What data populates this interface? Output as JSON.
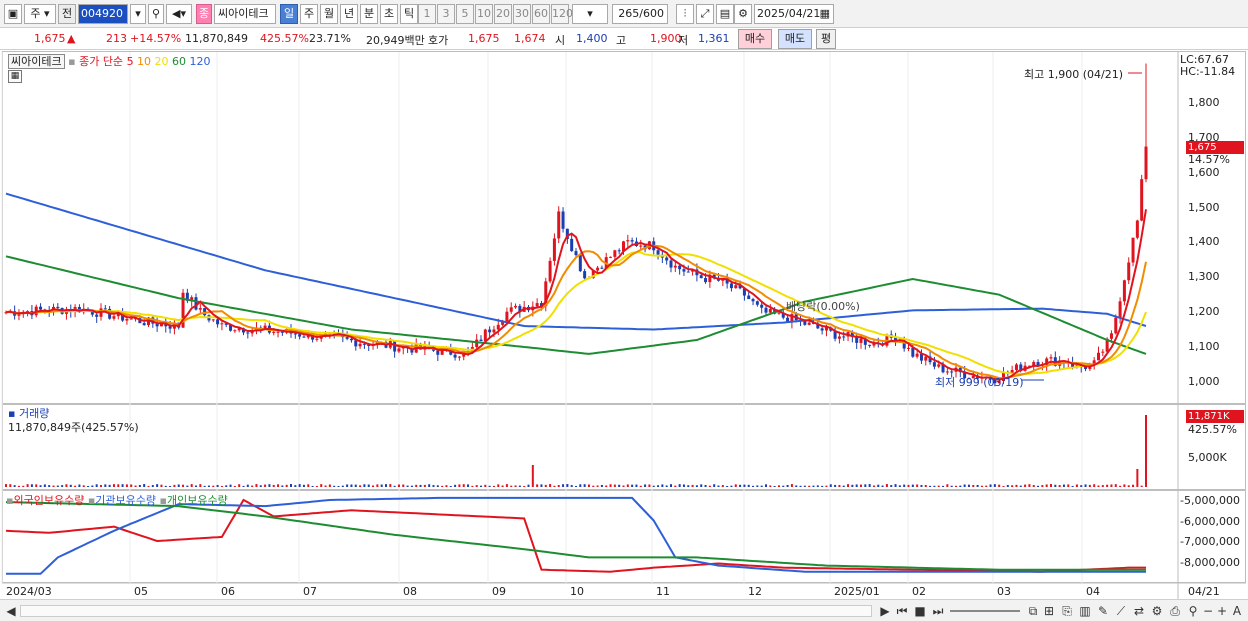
{
  "toolbar": {
    "type_label": "주",
    "prev_label": "전",
    "code_value": "004920",
    "company_badge": "종",
    "company_name": "씨아이테크",
    "periods": [
      "일",
      "주",
      "월",
      "년",
      "분",
      "초",
      "틱"
    ],
    "selected_period": "일",
    "minutes": [
      "1",
      "3",
      "5",
      "10",
      "20",
      "30",
      "60",
      "120"
    ],
    "count_value": "265",
    "count_total": "/600",
    "date_value": "2025/04/21"
  },
  "quote": {
    "price": "1,675",
    "change": "213",
    "change_pct": "+14.57%",
    "volume": "11,870,849",
    "volume_pct": "425.57%",
    "turnover": "23.71%",
    "amount": "20,949백만",
    "ask_label": "호가",
    "ask1": "1,675",
    "ask2": "1,674",
    "open_label": "시",
    "open": "1,400",
    "high_label": "고",
    "high": "1,900",
    "low_label": "저",
    "low": "1,361",
    "buy_label": "매수",
    "sell_label": "매도",
    "avg_label": "평"
  },
  "price_pane": {
    "stock_name": "씨아이테크",
    "ma_title": "종가 단순",
    "ma_periods": [
      "5",
      "10",
      "20",
      "60",
      "120"
    ],
    "ma_colors": [
      "#e0141e",
      "#f08c00",
      "#f0e000",
      "#1e8c32",
      "#2d5fd8"
    ],
    "lc_label": "LC:67.67",
    "hc_label": "HC:-11.84",
    "high_note": "최고 1,900 (04/21)",
    "low_note": "최저 999 (03/19)",
    "dividend_note": "배당락(0.00%)",
    "y_ticks": [
      "1,800",
      "1,700",
      "1,600",
      "1,500",
      "1,400",
      "1,300",
      "1,200",
      "1,100",
      "1,000"
    ],
    "current_badge": "1,675",
    "current_pct": "14.57%"
  },
  "volume_pane": {
    "title": "거래량",
    "value_text": "11,870,849주(425.57%)",
    "badge": "11,871K",
    "badge_pct": "425.57%",
    "y_tick": "5,000K"
  },
  "holding_pane": {
    "legend": [
      "외국인보유수량",
      "기관보유수량",
      "개인보유수량"
    ],
    "legend_colors": [
      "#e0141e",
      "#2d5fd8",
      "#1e8c32"
    ],
    "y_ticks": [
      "-5,000,000",
      "-6,000,000",
      "-7,000,000",
      "-8,000,000"
    ]
  },
  "x_axis": {
    "labels": [
      "2024/03",
      "05",
      "06",
      "07",
      "08",
      "09",
      "10",
      "11",
      "12",
      "2025/01",
      "02",
      "03",
      "04"
    ],
    "right_label": "04/21"
  },
  "chart_data": {
    "type": "line",
    "title": "",
    "x": [
      "2024/03",
      "05",
      "06",
      "07",
      "08",
      "09",
      "10",
      "11",
      "12",
      "2025/01",
      "02",
      "03",
      "04",
      "04/21"
    ],
    "series": [
      {
        "name": "종가",
        "values": [
          1200,
          1170,
          1230,
          1130,
          1100,
          1080,
          1550,
          1400,
          1220,
          1150,
          1120,
          1010,
          1050,
          1675
        ]
      },
      {
        "name": "120",
        "values": [
          1540,
          1380,
          1300,
          1230,
          1170,
          1150,
          1160,
          1190,
          1210,
          1210,
          1200,
          1190,
          1170,
          1160
        ]
      },
      {
        "name": "60",
        "values": [
          1360,
          1260,
          1200,
          1150,
          1120,
          1090,
          1150,
          1250,
          1300,
          1260,
          1180,
          1110,
          1080,
          1080
        ]
      }
    ],
    "ylim": [
      960,
      1900
    ],
    "volume_last": 11870849
  }
}
